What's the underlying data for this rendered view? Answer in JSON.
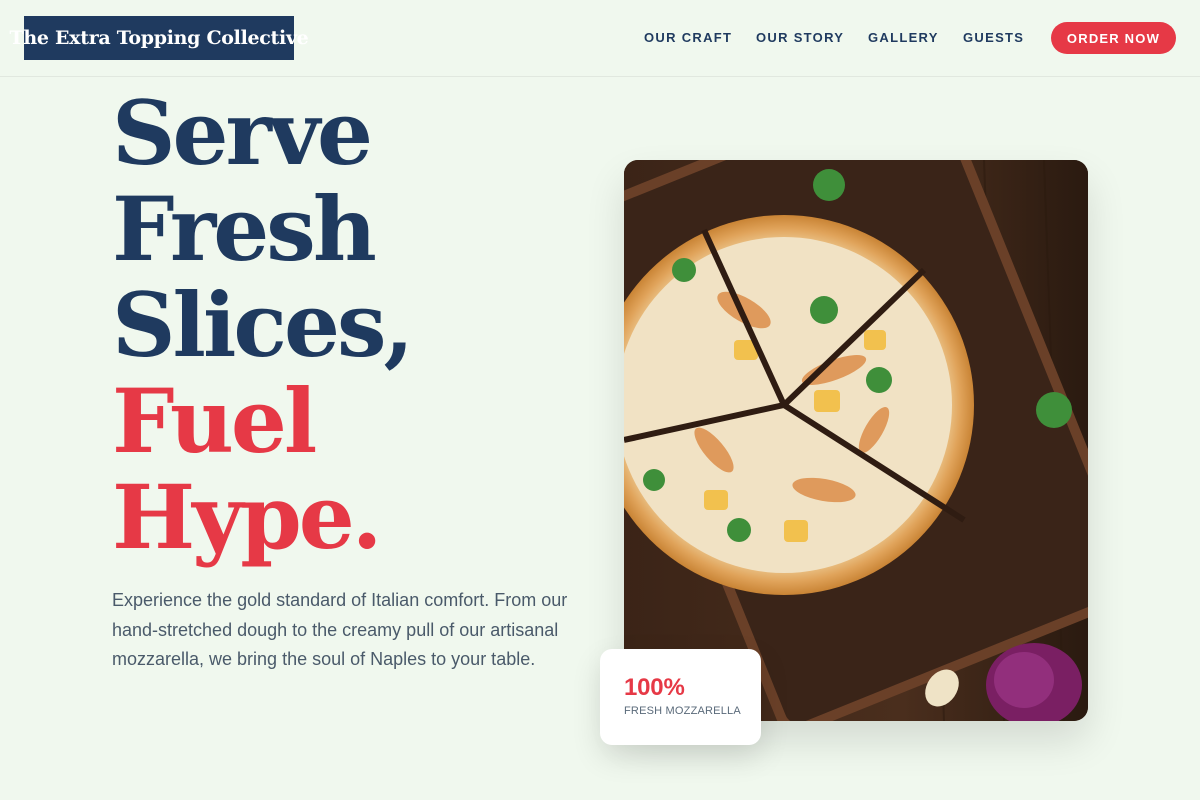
{
  "brand": {
    "name": "The Extra Topping Collective"
  },
  "nav": {
    "items": [
      {
        "label": "OUR CRAFT"
      },
      {
        "label": "OUR STORY"
      },
      {
        "label": "GALLERY"
      },
      {
        "label": "GUESTS"
      }
    ],
    "cta_label": "ORDER NOW"
  },
  "hero": {
    "headline_lines": [
      "Serve",
      "Fresh",
      "Slices,",
      "Fuel",
      "Hype."
    ],
    "description": "Experience the gold standard of Italian comfort. From our hand-stretched dough to the creamy pull of our artisanal mozzarella, we bring the soul of Naples to your table.",
    "stat": {
      "value": "100%",
      "label": "FRESH MOZZARELLA"
    }
  },
  "image": {
    "subject": "pizza-on-wooden-board"
  },
  "colors": {
    "navy": "#1f3a5f",
    "accent_red": "#e63946",
    "background": "#f0f8ee"
  }
}
